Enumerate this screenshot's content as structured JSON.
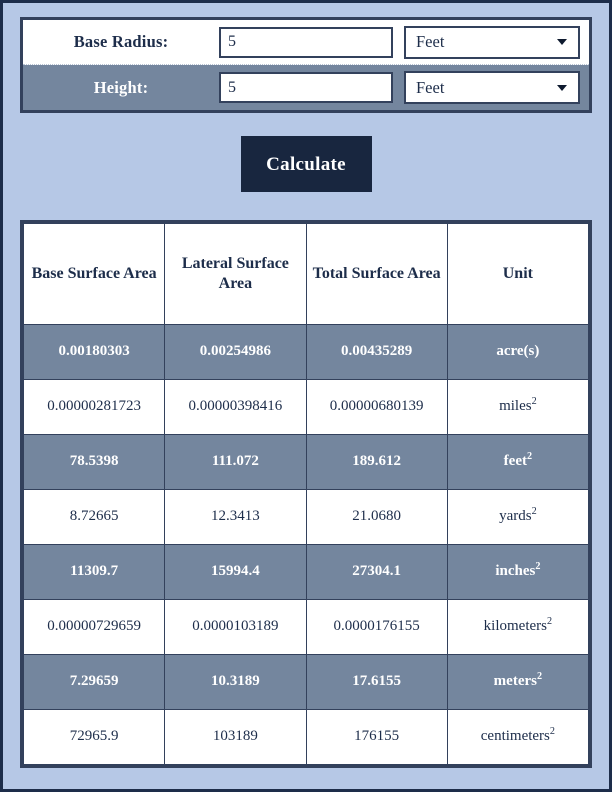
{
  "form": {
    "rows": [
      {
        "label": "Base Radius:",
        "value": "5",
        "unit": "Feet",
        "arrow_icon": "chevron-down-icon"
      },
      {
        "label": "Height:",
        "value": "5",
        "unit": "Feet",
        "arrow_icon": "chevron-down-icon"
      }
    ]
  },
  "actions": {
    "calculate_label": "Calculate"
  },
  "results": {
    "headers": [
      "Base Surface Area",
      "Lateral Surface Area",
      "Total Surface Area",
      "Unit"
    ],
    "rows": [
      {
        "base": "0.00180303",
        "lateral": "0.00254986",
        "total": "0.00435289",
        "unit": "acre(s)",
        "unit_sup": "",
        "shaded": true
      },
      {
        "base": "0.00000281723",
        "lateral": "0.00000398416",
        "total": "0.00000680139",
        "unit": "miles",
        "unit_sup": "2",
        "shaded": false
      },
      {
        "base": "78.5398",
        "lateral": "111.072",
        "total": "189.612",
        "unit": "feet",
        "unit_sup": "2",
        "shaded": true
      },
      {
        "base": "8.72665",
        "lateral": "12.3413",
        "total": "21.0680",
        "unit": "yards",
        "unit_sup": "2",
        "shaded": false
      },
      {
        "base": "11309.7",
        "lateral": "15994.4",
        "total": "27304.1",
        "unit": "inches",
        "unit_sup": "2",
        "shaded": true
      },
      {
        "base": "0.00000729659",
        "lateral": "0.0000103189",
        "total": "0.0000176155",
        "unit": "kilometers",
        "unit_sup": "2",
        "shaded": false
      },
      {
        "base": "7.29659",
        "lateral": "10.3189",
        "total": "17.6155",
        "unit": "meters",
        "unit_sup": "2",
        "shaded": true
      },
      {
        "base": "72965.9",
        "lateral": "103189",
        "total": "176155",
        "unit": "centimeters",
        "unit_sup": "2",
        "shaded": false
      }
    ]
  },
  "colors": {
    "page_background": "#b6c8e6",
    "border": "#33415c",
    "shaded_row": "#74869e",
    "text_dark": "#1d2d4a",
    "button_background": "#18263f",
    "button_text": "#ffffff"
  }
}
